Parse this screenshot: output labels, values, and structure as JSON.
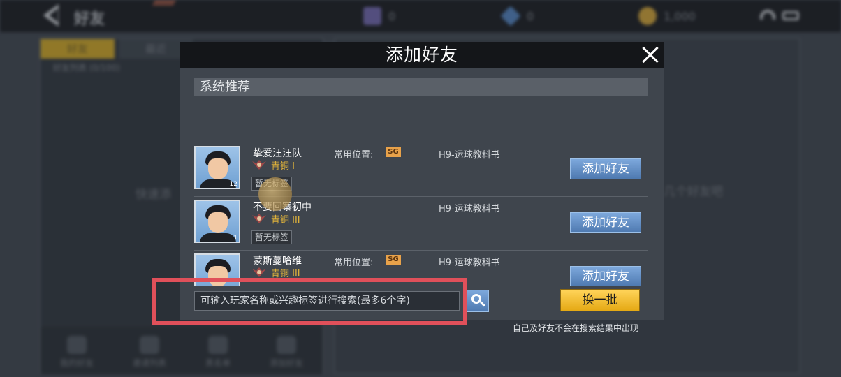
{
  "background": {
    "top_title": "好友",
    "currencies": [
      {
        "icon": "purple-ticket-icon",
        "value": "0",
        "color": "#6b62a8"
      },
      {
        "icon": "blue-gem-icon",
        "value": "0",
        "color": "#4d7db8"
      },
      {
        "icon": "gold-coin-icon",
        "value": "1,000",
        "color": "#c99d34"
      }
    ],
    "tabs": [
      "好友",
      "最近"
    ],
    "friend_count": "好友列表 (0/100)",
    "left_hint": "快速添",
    "right_hint": "几个好友吧",
    "bottom_buttons": [
      "我的好友",
      "邀请列表",
      "黑名单",
      "添加好友"
    ]
  },
  "modal": {
    "title": "添加好友",
    "section_label": "系统推荐",
    "players": [
      {
        "name": "挚爱汪汪队",
        "rank": "青铜 I",
        "tag": "暂无标签",
        "position_label": "常用位置:",
        "position": "SG",
        "school": "H9-运球教科书",
        "jersey": "12",
        "add_label": "添加好友"
      },
      {
        "name": "不要回寨初中",
        "rank": "青铜 III",
        "tag": "暂无标签",
        "position_label": "",
        "position": "",
        "school": "H9-运球教科书",
        "jersey": "1",
        "add_label": "添加好友"
      },
      {
        "name": "蒙斯蔓哈维",
        "rank": "青铜 III",
        "tag": "",
        "position_label": "常用位置:",
        "position": "SG",
        "school": "H9-运球教科书",
        "jersey": "",
        "add_label": "添加好友"
      }
    ],
    "search": {
      "placeholder": "可输入玩家名称或兴趣标签进行搜索(最多6个字)"
    },
    "refresh_label": "换一批",
    "note": "自己及好友不会在搜索结果中出现"
  },
  "colors": {
    "accent_gold": "#f2bd2c",
    "button_blue": "#5f8bc4",
    "highlight_red": "#e0505a",
    "rank_bronze": "#e0b33a"
  }
}
